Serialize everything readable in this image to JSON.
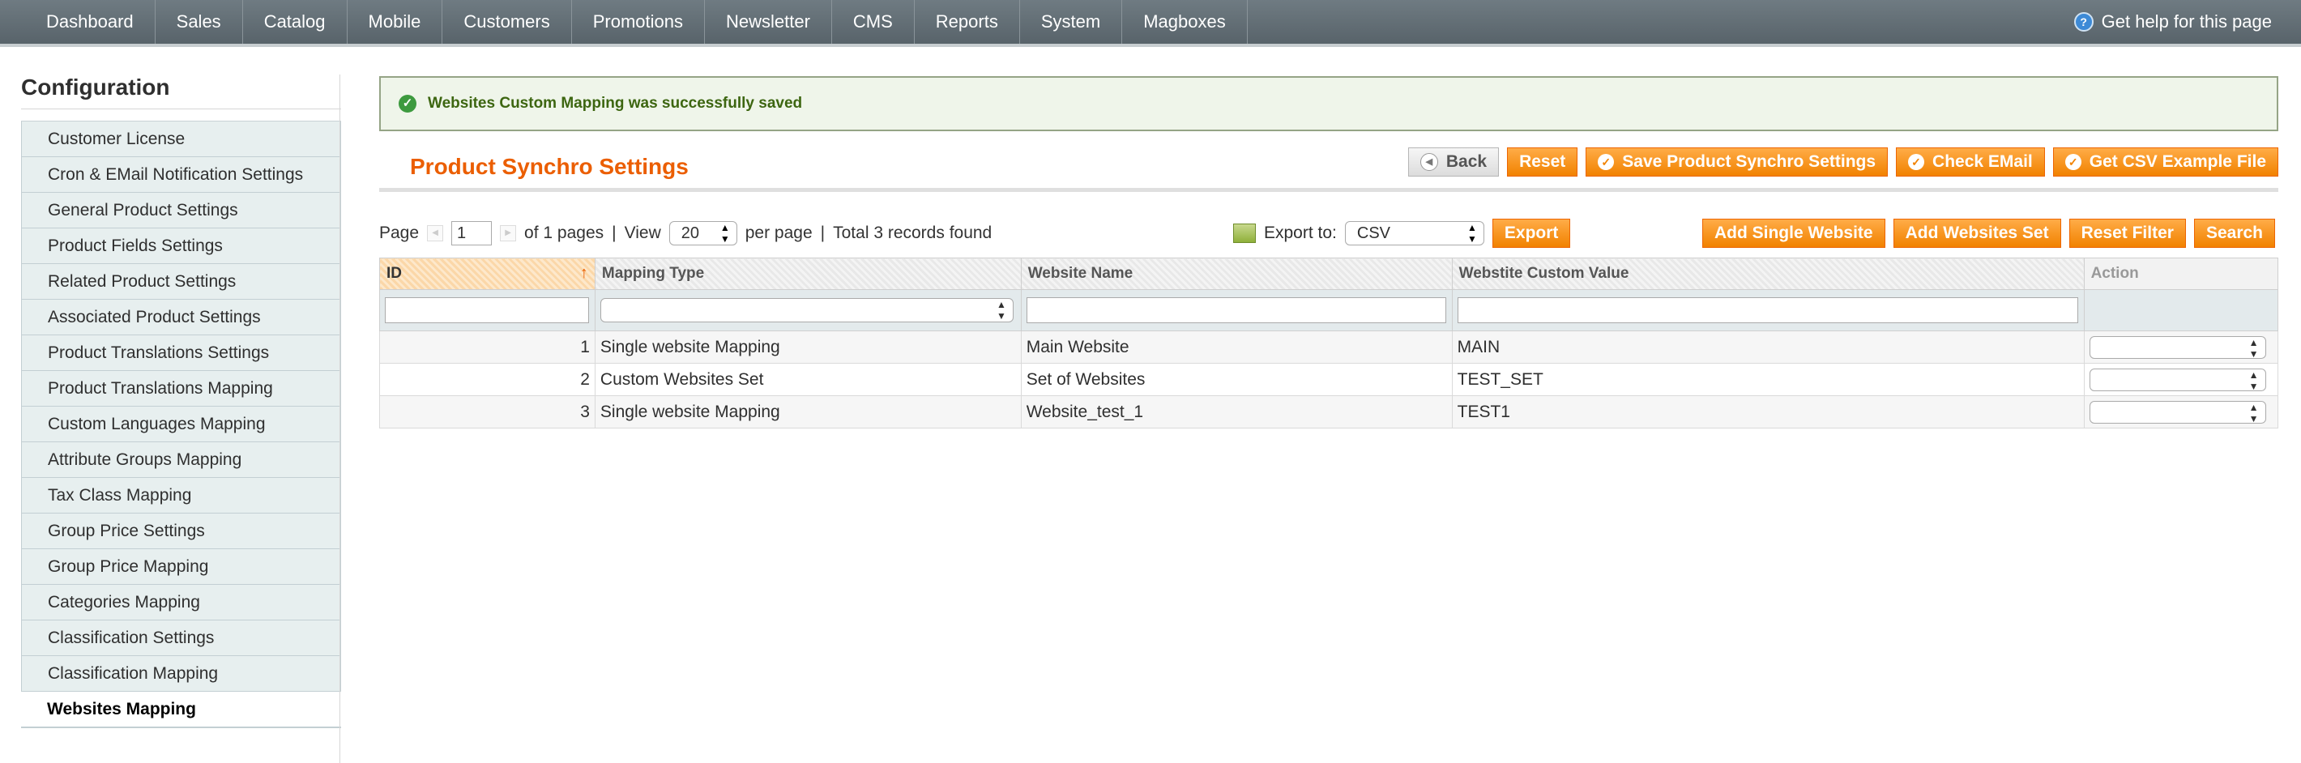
{
  "nav": {
    "items": [
      "Dashboard",
      "Sales",
      "Catalog",
      "Mobile",
      "Customers",
      "Promotions",
      "Newsletter",
      "CMS",
      "Reports",
      "System",
      "Magboxes"
    ],
    "help": "Get help for this page"
  },
  "sidebar": {
    "title": "Configuration",
    "items": [
      "Customer License",
      "Cron & EMail Notification Settings",
      "General Product Settings",
      "Product Fields Settings",
      "Related Product Settings",
      "Associated Product Settings",
      "Product Translations Settings",
      "Product Translations Mapping",
      "Custom Languages Mapping",
      "Attribute Groups Mapping",
      "Tax Class Mapping",
      "Group Price Settings",
      "Group Price Mapping",
      "Categories Mapping",
      "Classification Settings",
      "Classification Mapping",
      "Websites Mapping"
    ]
  },
  "message": "Websites Custom Mapping was successfully saved",
  "page": {
    "title": "Product Synchro Settings",
    "buttons": {
      "back": "Back",
      "reset": "Reset",
      "save": "Save Product Synchro Settings",
      "check_email": "Check EMail",
      "csv_example": "Get CSV Example File"
    }
  },
  "pager": {
    "page_label": "Page",
    "page_value": "1",
    "of_pages": "of 1 pages",
    "sep1": "|",
    "view_label": "View",
    "per_page_value": "20",
    "per_page_label": "per page",
    "sep2": "|",
    "total": "Total 3 records found"
  },
  "export": {
    "label": "Export to:",
    "format": "CSV",
    "button": "Export"
  },
  "grid_buttons": {
    "add_single": "Add Single Website",
    "add_set": "Add Websites Set",
    "reset_filter": "Reset Filter",
    "search": "Search"
  },
  "table": {
    "columns": [
      "ID",
      "Mapping Type",
      "Website Name",
      "Webstite Custom Value",
      "Action"
    ],
    "rows": [
      {
        "id": "1",
        "type": "Single website Mapping",
        "name": "Main Website",
        "value": "MAIN"
      },
      {
        "id": "2",
        "type": "Custom Websites Set",
        "name": "Set of Websites",
        "value": "TEST_SET"
      },
      {
        "id": "3",
        "type": "Single website Mapping",
        "name": "Website_test_1",
        "value": "TEST1"
      }
    ]
  }
}
